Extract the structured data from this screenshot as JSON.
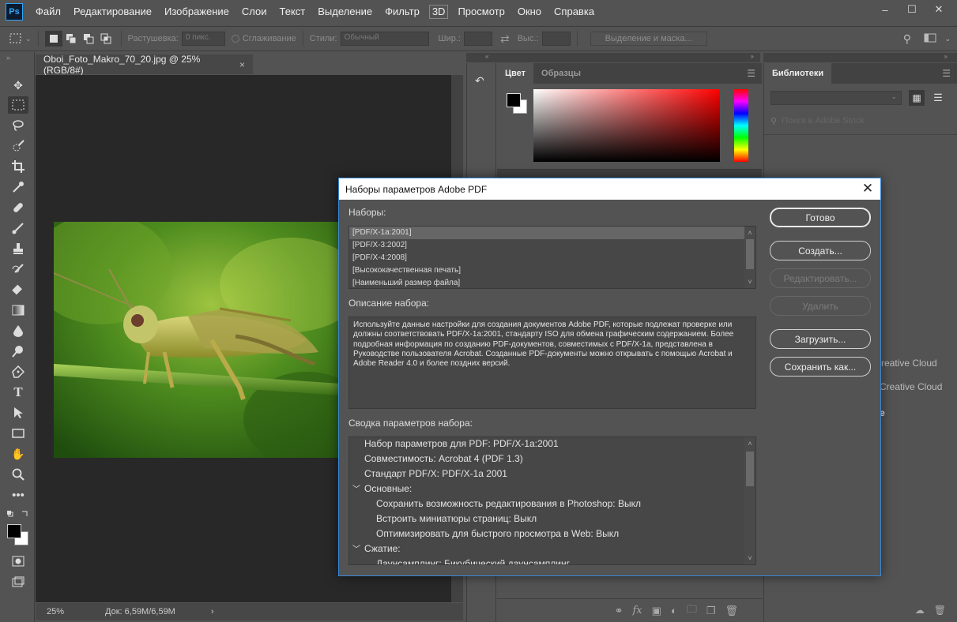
{
  "app": {
    "logo": "Ps"
  },
  "menu": [
    "Файл",
    "Редактирование",
    "Изображение",
    "Слои",
    "Текст",
    "Выделение",
    "Фильтр",
    "3D",
    "Просмотр",
    "Окно",
    "Справка"
  ],
  "options": {
    "feather_label": "Растушевка:",
    "feather_value": "0 пикс.",
    "antialias_label": "Сглаживание",
    "style_label": "Стили:",
    "style_value": "Обычный",
    "width_label": "Шир.:",
    "height_label": "Выс.:",
    "mask_button": "Выделение и маска..."
  },
  "document": {
    "tab_title": "Oboi_Foto_Makro_70_20.jpg @ 25% (RGB/8#)",
    "zoom": "25%",
    "doc_info": "Док: 6,59M/6,59M"
  },
  "panels": {
    "color_tab": "Цвет",
    "swatches_tab": "Образцы",
    "libraries_tab": "Библиотеки",
    "library_search_placeholder": "Поиск в Adobe Stock",
    "cc_text_1": "reative Cloud",
    "cc_text_2": "Creative Cloud",
    "cc_text_3": "e"
  },
  "dialog": {
    "title": "Наборы параметров Adobe PDF",
    "presets_label": "Наборы:",
    "presets": [
      "[PDF/X-1a:2001]",
      "[PDF/X-3:2002]",
      "[PDF/X-4:2008]",
      "[Высококачественная печать]",
      "[Наименьший размер файла]"
    ],
    "description_label": "Описание набора:",
    "description": "Используйте данные настройки для создания документов Adobe PDF, которые подлежат проверке или должны соответствовать PDF/X-1a:2001, стандарту ISO для обмена графическим содержанием.  Более подробная информация по созданию PDF-документов, совместимых с PDF/X-1a, представлена в Руководстве пользователя Acrobat.  Созданные PDF-документы можно открывать с помощью Acrobat и Adobe Reader 4.0 и более поздних версий.",
    "summary_label": "Сводка параметров набора:",
    "summary": [
      {
        "text": "Набор параметров для PDF:  PDF/X-1a:2001",
        "indent": 1
      },
      {
        "text": "Совместимость: Acrobat 4 (PDF 1.3)",
        "indent": 1
      },
      {
        "text": "Стандарт PDF/X:  PDF/X-1a 2001",
        "indent": 1
      },
      {
        "text": "Основные:",
        "indent": 0,
        "expander": "﹀"
      },
      {
        "text": "Сохранить возможность редактирования в Photoshop: Выкл",
        "indent": 2
      },
      {
        "text": "Встроить миниатюры страниц: Выкл",
        "indent": 2
      },
      {
        "text": "Оптимизировать для быстрого просмотра в Web:  Выкл",
        "indent": 2
      },
      {
        "text": "Сжатие:",
        "indent": 0,
        "expander": "﹀"
      },
      {
        "text": "Даунсамплинг:  Бикубический даунсамплинг",
        "indent": 2
      }
    ],
    "buttons": {
      "done": "Готово",
      "create": "Создать...",
      "edit": "Редактировать...",
      "delete": "Удалить",
      "load": "Загрузить...",
      "save_as": "Сохранить как..."
    }
  },
  "colors": {
    "dialog_border": "#3a87d6",
    "ps_blue": "#31a8ff"
  }
}
